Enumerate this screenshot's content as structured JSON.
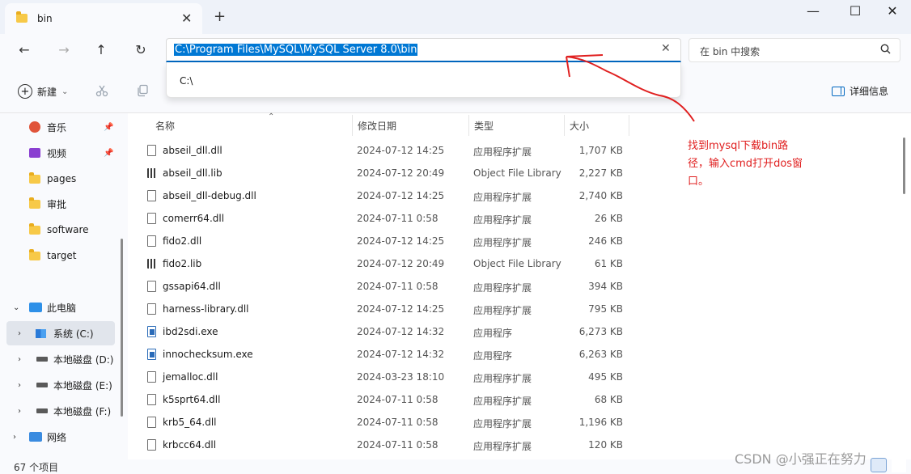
{
  "window": {
    "tab_title": "bin",
    "tab_close": "✕",
    "new_tab": "+",
    "minimize": "—",
    "maximize": "☐",
    "close": "✕"
  },
  "nav": {
    "back": "←",
    "forward": "→",
    "up": "↑",
    "refresh": "↻",
    "address": "C:\\Program Files\\MySQL\\MySQL Server 8.0\\bin",
    "suggestion": "C:\\",
    "clear": "✕",
    "search_placeholder": "在 bin 中搜索"
  },
  "toolbar": {
    "new_label": "新建",
    "new_chevron": "⌄",
    "details_label": "详细信息"
  },
  "sidebar": {
    "items": [
      {
        "label": "音乐",
        "icon": "music-icon",
        "pinned": true
      },
      {
        "label": "视频",
        "icon": "video-icon",
        "pinned": true
      },
      {
        "label": "pages",
        "icon": "folder-icon"
      },
      {
        "label": "审批",
        "icon": "folder-icon"
      },
      {
        "label": "software",
        "icon": "folder-icon"
      },
      {
        "label": "target",
        "icon": "folder-icon"
      },
      {
        "label": "此电脑",
        "icon": "pc-icon",
        "expanded": true
      },
      {
        "label": "系统 (C:)",
        "icon": "windows-drive-icon",
        "selected": true
      },
      {
        "label": "本地磁盘 (D:)",
        "icon": "drive-icon"
      },
      {
        "label": "本地磁盘 (E:)",
        "icon": "drive-icon"
      },
      {
        "label": "本地磁盘 (F:)",
        "icon": "drive-icon"
      },
      {
        "label": "网络",
        "icon": "network-icon"
      }
    ]
  },
  "columns": {
    "name": "名称",
    "date": "修改日期",
    "type": "类型",
    "size": "大小"
  },
  "files": [
    {
      "name": "abseil_dll.dll",
      "date": "2024-07-12 14:25",
      "type": "应用程序扩展",
      "size": "1,707 KB",
      "icon": "dll"
    },
    {
      "name": "abseil_dll.lib",
      "date": "2024-07-12 20:49",
      "type": "Object File Library",
      "size": "2,227 KB",
      "icon": "lib"
    },
    {
      "name": "abseil_dll-debug.dll",
      "date": "2024-07-12 14:25",
      "type": "应用程序扩展",
      "size": "2,740 KB",
      "icon": "dll"
    },
    {
      "name": "comerr64.dll",
      "date": "2024-07-11 0:58",
      "type": "应用程序扩展",
      "size": "26 KB",
      "icon": "dll"
    },
    {
      "name": "fido2.dll",
      "date": "2024-07-12 14:25",
      "type": "应用程序扩展",
      "size": "246 KB",
      "icon": "dll"
    },
    {
      "name": "fido2.lib",
      "date": "2024-07-12 20:49",
      "type": "Object File Library",
      "size": "61 KB",
      "icon": "lib"
    },
    {
      "name": "gssapi64.dll",
      "date": "2024-07-11 0:58",
      "type": "应用程序扩展",
      "size": "394 KB",
      "icon": "dll"
    },
    {
      "name": "harness-library.dll",
      "date": "2024-07-12 14:25",
      "type": "应用程序扩展",
      "size": "795 KB",
      "icon": "dll"
    },
    {
      "name": "ibd2sdi.exe",
      "date": "2024-07-12 14:32",
      "type": "应用程序",
      "size": "6,273 KB",
      "icon": "exe"
    },
    {
      "name": "innochecksum.exe",
      "date": "2024-07-12 14:32",
      "type": "应用程序",
      "size": "6,263 KB",
      "icon": "exe"
    },
    {
      "name": "jemalloc.dll",
      "date": "2024-03-23 18:10",
      "type": "应用程序扩展",
      "size": "495 KB",
      "icon": "dll"
    },
    {
      "name": "k5sprt64.dll",
      "date": "2024-07-11 0:58",
      "type": "应用程序扩展",
      "size": "68 KB",
      "icon": "dll"
    },
    {
      "name": "krb5_64.dll",
      "date": "2024-07-11 0:58",
      "type": "应用程序扩展",
      "size": "1,196 KB",
      "icon": "dll"
    },
    {
      "name": "krbcc64.dll",
      "date": "2024-07-11 0:58",
      "type": "应用程序扩展",
      "size": "120 KB",
      "icon": "dll"
    }
  ],
  "status": {
    "count": "67 个项目"
  },
  "annotation": {
    "text": "找到mysql下载bin路径，输入cmd打开dos窗口。",
    "color": "#e02020"
  },
  "watermark": "CSDN @小强正在努力",
  "colors": {
    "accent": "#0067c0",
    "selection": "#0078d4"
  }
}
